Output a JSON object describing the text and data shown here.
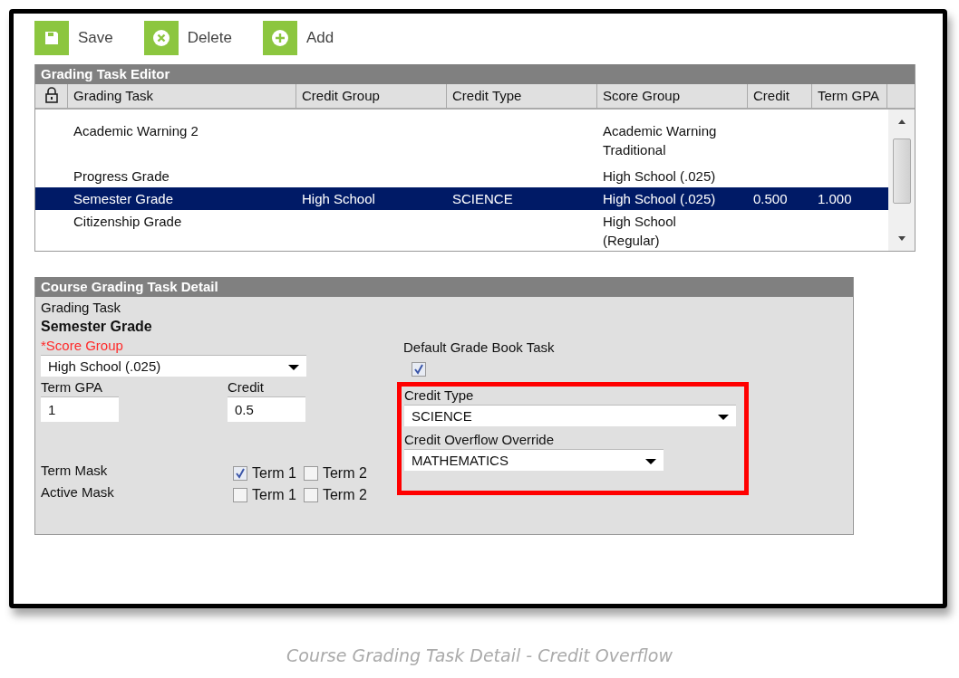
{
  "toolbar": [
    {
      "kind": "save",
      "label": "Save"
    },
    {
      "kind": "delete",
      "label": "Delete"
    },
    {
      "kind": "add",
      "label": "Add"
    }
  ],
  "editor": {
    "title": "Grading Task Editor",
    "columns": [
      "Grading Task",
      "Credit Group",
      "Credit Type",
      "Score Group",
      "Credit",
      "Term GPA"
    ],
    "rows": [
      {
        "selected": false,
        "cells": [
          "Academic Warning 2",
          "",
          "",
          "Academic Warning\nTraditional",
          "",
          ""
        ]
      },
      {
        "selected": false,
        "cells": [
          "Progress Grade",
          "",
          "",
          "High School (.025)",
          "",
          ""
        ]
      },
      {
        "selected": true,
        "cells": [
          "Semester Grade",
          "High School",
          "SCIENCE",
          "High School (.025)",
          "0.500",
          "1.000"
        ]
      },
      {
        "selected": false,
        "cells": [
          "Citizenship Grade",
          "",
          "",
          "High School\n(Regular)",
          "",
          ""
        ]
      }
    ]
  },
  "detail": {
    "title": "Course Grading Task Detail",
    "grading_task": {
      "label": "Grading Task",
      "value": "Semester Grade"
    },
    "score_group": {
      "label": "*Score Group",
      "required": true,
      "value": "High School (.025)"
    },
    "term_gpa": {
      "label": "Term GPA",
      "value": "1"
    },
    "credit": {
      "label": "Credit",
      "value": "0.5"
    },
    "default_grade_book_task": {
      "label": "Default Grade Book Task",
      "checked": true
    },
    "credit_type": {
      "label": "Credit Type",
      "value": "SCIENCE"
    },
    "credit_overflow_override": {
      "label": "Credit Overflow Override",
      "value": "MATHEMATICS"
    },
    "masks": [
      {
        "label": "Term Mask",
        "options": [
          {
            "label": "Term 1",
            "checked": true
          },
          {
            "label": "Term 2",
            "checked": false
          }
        ]
      },
      {
        "label": "Active Mask",
        "options": [
          {
            "label": "Term 1",
            "checked": false
          },
          {
            "label": "Term 2",
            "checked": false
          }
        ]
      }
    ]
  },
  "caption": "Course Grading Task Detail - Credit Overflow"
}
